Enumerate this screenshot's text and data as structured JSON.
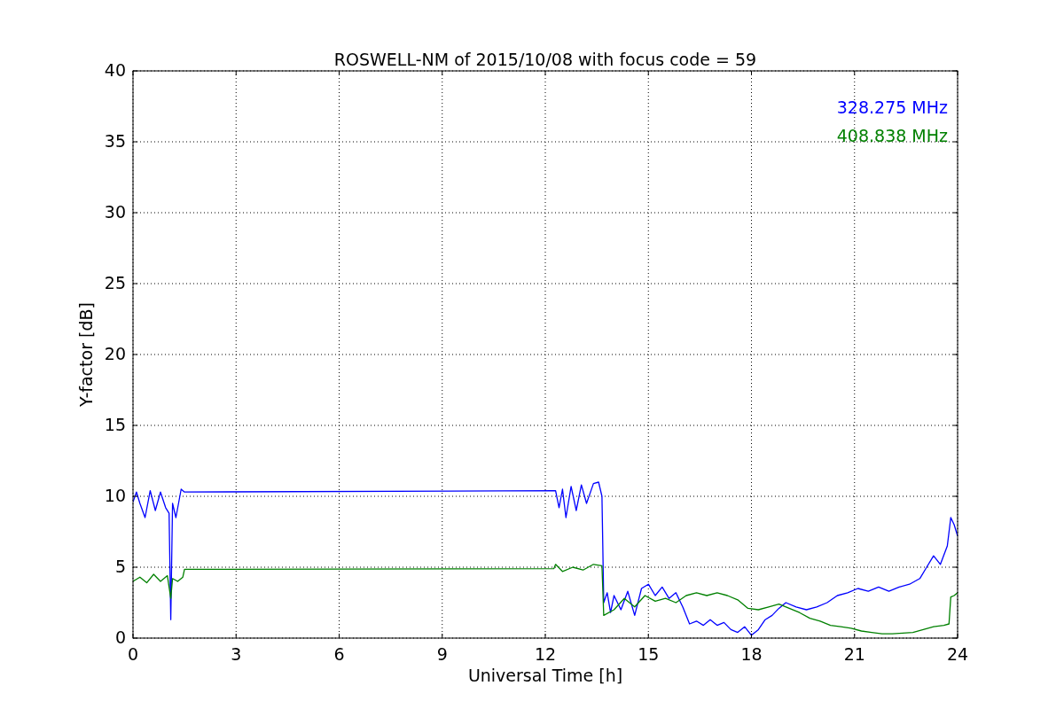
{
  "chart_data": {
    "type": "line",
    "grid": true,
    "title": "ROSWELL-NM of 2015/10/08 with focus code = 59",
    "xlabel": "Universal Time [h]",
    "ylabel": "Y-factor [dB]",
    "xlim": [
      0,
      24
    ],
    "ylim": [
      0,
      40
    ],
    "xticks": [
      0,
      3,
      6,
      9,
      12,
      15,
      18,
      21,
      24
    ],
    "yticks": [
      0,
      5,
      10,
      15,
      20,
      25,
      30,
      35,
      40
    ],
    "series": [
      {
        "name": "328.275 MHz",
        "color": "#0000ff",
        "x": [
          0,
          0.1,
          0.2,
          0.35,
          0.5,
          0.65,
          0.8,
          0.95,
          1.05,
          1.1,
          1.15,
          1.25,
          1.4,
          1.5,
          12.3,
          12.4,
          12.5,
          12.6,
          12.75,
          12.9,
          13.05,
          13.2,
          13.4,
          13.55,
          13.65,
          13.7,
          13.8,
          13.9,
          14.0,
          14.2,
          14.4,
          14.6,
          14.8,
          15.0,
          15.2,
          15.4,
          15.6,
          15.8,
          16.0,
          16.2,
          16.4,
          16.6,
          16.8,
          17.0,
          17.2,
          17.4,
          17.6,
          17.8,
          18.0,
          18.2,
          18.4,
          18.6,
          18.8,
          19.0,
          19.3,
          19.6,
          19.9,
          20.2,
          20.5,
          20.8,
          21.1,
          21.4,
          21.7,
          22.0,
          22.3,
          22.6,
          22.9,
          23.1,
          23.3,
          23.5,
          23.7,
          23.8,
          23.9,
          24.0
        ],
        "values": [
          9.6,
          10.3,
          9.5,
          8.5,
          10.4,
          9.0,
          10.3,
          9.2,
          8.8,
          1.3,
          9.5,
          8.5,
          10.5,
          10.3,
          10.4,
          9.2,
          10.5,
          8.5,
          10.7,
          9.0,
          10.8,
          9.5,
          10.9,
          11.0,
          10.0,
          2.5,
          3.2,
          1.8,
          3.0,
          2.0,
          3.3,
          1.6,
          3.5,
          3.8,
          3.0,
          3.6,
          2.8,
          3.2,
          2.2,
          1.0,
          1.2,
          0.9,
          1.3,
          0.9,
          1.1,
          0.6,
          0.4,
          0.8,
          0.2,
          0.6,
          1.3,
          1.6,
          2.1,
          2.5,
          2.2,
          2.0,
          2.2,
          2.5,
          3.0,
          3.2,
          3.5,
          3.3,
          3.6,
          3.3,
          3.6,
          3.8,
          4.2,
          5.0,
          5.8,
          5.2,
          6.5,
          8.5,
          8.0,
          7.2
        ]
      },
      {
        "name": "408.838 MHz",
        "color": "#008000",
        "x": [
          0,
          0.2,
          0.4,
          0.6,
          0.8,
          1.0,
          1.1,
          1.15,
          1.3,
          1.45,
          1.5,
          12.25,
          12.3,
          12.5,
          12.8,
          13.1,
          13.4,
          13.65,
          13.7,
          14.0,
          14.3,
          14.6,
          14.9,
          15.2,
          15.5,
          15.8,
          16.1,
          16.4,
          16.7,
          17.0,
          17.3,
          17.6,
          17.9,
          18.2,
          18.5,
          18.8,
          19.1,
          19.4,
          19.7,
          20.0,
          20.3,
          20.6,
          20.9,
          21.2,
          21.5,
          21.8,
          22.1,
          22.4,
          22.7,
          23.0,
          23.3,
          23.6,
          23.75,
          23.8,
          23.9,
          24.0
        ],
        "values": [
          4.0,
          4.3,
          3.9,
          4.5,
          4.0,
          4.4,
          2.8,
          4.2,
          4.0,
          4.3,
          4.85,
          4.9,
          5.2,
          4.7,
          5.0,
          4.8,
          5.2,
          5.1,
          1.6,
          2.0,
          2.8,
          2.2,
          3.0,
          2.6,
          2.8,
          2.5,
          3.0,
          3.2,
          3.0,
          3.2,
          3.0,
          2.7,
          2.1,
          2.0,
          2.2,
          2.4,
          2.1,
          1.8,
          1.4,
          1.2,
          0.9,
          0.8,
          0.7,
          0.5,
          0.4,
          0.3,
          0.3,
          0.35,
          0.4,
          0.6,
          0.8,
          0.9,
          1.0,
          2.9,
          3.0,
          3.2
        ]
      }
    ]
  }
}
